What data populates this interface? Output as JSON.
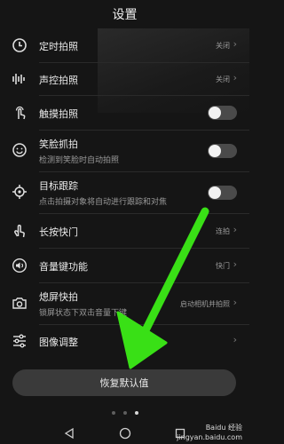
{
  "header": {
    "title": "设置"
  },
  "rows": [
    {
      "label": "定时拍照",
      "value": "关闭",
      "icon": "clock-icon"
    },
    {
      "label": "声控拍照",
      "value": "关闭",
      "icon": "sound-wave-icon"
    },
    {
      "label": "触摸拍照",
      "toggle": "off",
      "icon": "touch-icon"
    },
    {
      "label": "笑脸抓拍",
      "sub": "检测到笑脸时自动拍照",
      "toggle": "off",
      "icon": "smile-icon"
    },
    {
      "label": "目标跟踪",
      "sub": "点击拍摄对象将自动进行跟踪和对焦",
      "toggle": "off",
      "icon": "target-icon"
    },
    {
      "label": "长按快门",
      "value": "连拍",
      "icon": "hand-icon"
    },
    {
      "label": "音量键功能",
      "value": "快门",
      "icon": "volume-icon"
    },
    {
      "label": "熄屏快拍",
      "sub": "锁屏状态下双击音量下键",
      "value": "启动相机并拍照",
      "icon": "camera-lock-icon"
    },
    {
      "label": "图像调整",
      "icon": "sliders-icon"
    }
  ],
  "reset_button": {
    "label": "恢复默认值"
  },
  "watermark": {
    "line1": "Baidu 经验",
    "line2": "jingyan.baidu.com"
  },
  "colors": {
    "background": "#151515",
    "annotation_arrow": "#39e016"
  }
}
